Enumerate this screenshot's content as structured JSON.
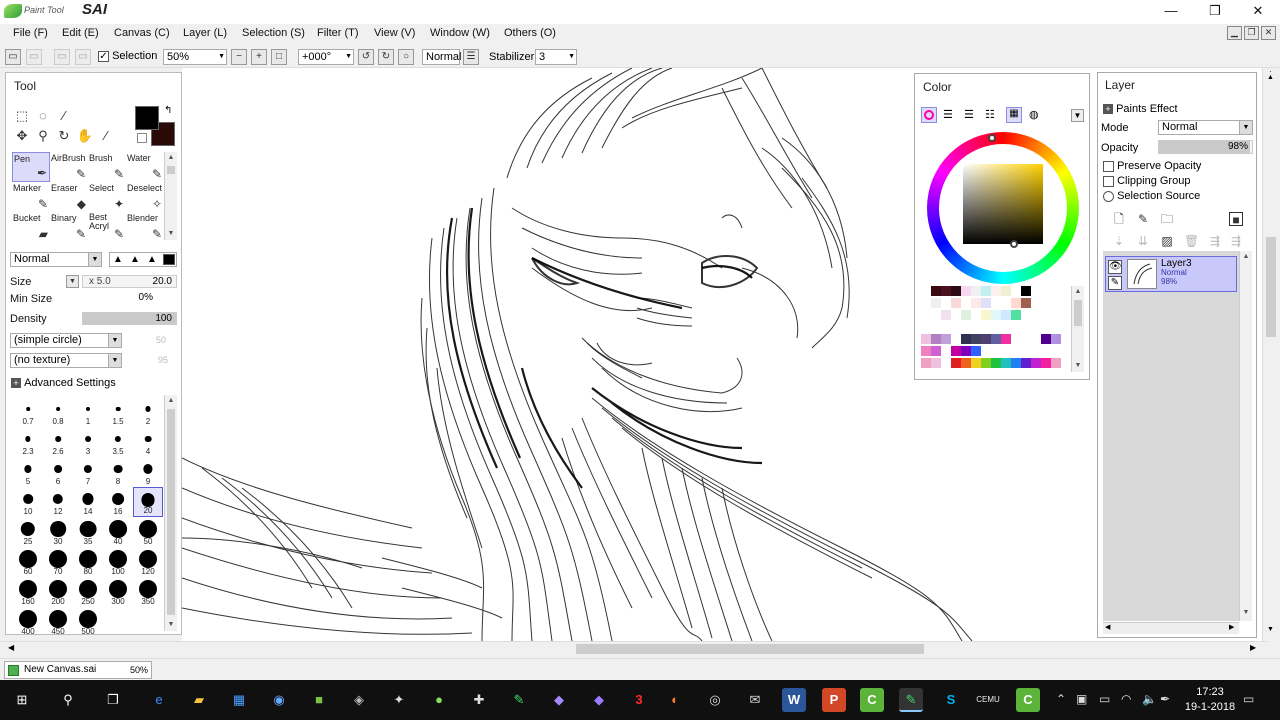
{
  "app": {
    "logo_small": "Paint Tool",
    "logo_big": "SAI"
  },
  "window_controls": {
    "minimize": "—",
    "restore": "❐",
    "close": "✕"
  },
  "menu": [
    "File (F)",
    "Edit (E)",
    "Canvas (C)",
    "Layer (L)",
    "Selection (S)",
    "Filter (T)",
    "View (V)",
    "Window (W)",
    "Others (O)"
  ],
  "toolbar": {
    "selection_checked": true,
    "selection_label": "Selection",
    "zoom": "50%",
    "rotation": "+000°",
    "blend_mode": "Normal",
    "stabilizer_label": "Stabilizer",
    "stabilizer_value": "3"
  },
  "tool_panel": {
    "title": "Tool",
    "brushes": [
      {
        "label": "Pen",
        "icon": "pen-icon",
        "glyph": "✒",
        "active": true
      },
      {
        "label": "AirBrush",
        "icon": "airbrush-icon",
        "glyph": "✎"
      },
      {
        "label": "Brush",
        "icon": "brush-icon",
        "glyph": "🖌"
      },
      {
        "label": "Water",
        "icon": "water-icon",
        "glyph": "✎"
      },
      {
        "label": "Marker",
        "icon": "marker-icon",
        "glyph": "✎"
      },
      {
        "label": "Eraser",
        "icon": "eraser-icon",
        "glyph": "◆"
      },
      {
        "label": "Select",
        "icon": "select-brush-icon",
        "glyph": "✦"
      },
      {
        "label": "Deselect",
        "icon": "deselect-brush-icon",
        "glyph": "✧"
      },
      {
        "label": "Bucket",
        "icon": "bucket-icon",
        "glyph": "▰"
      },
      {
        "label": "Binary",
        "icon": "binary-icon",
        "glyph": "✎"
      },
      {
        "label": "Best Acryl",
        "icon": "acrylic-icon",
        "glyph": "✎"
      },
      {
        "label": "Blender",
        "icon": "blender-icon",
        "glyph": "✎"
      }
    ],
    "mode": "Normal",
    "size_label": "Size",
    "size_multiplier": "x 5.0",
    "size_value": "20.0",
    "min_size_label": "Min Size",
    "min_size_value": "0%",
    "density_label": "Density",
    "density_value": "100",
    "density_fraction": 1.0,
    "brush_shape": "(simple circle)",
    "brush_shape_value": "50",
    "texture": "(no texture)",
    "texture_value": "95",
    "advanced_label": "Advanced Settings",
    "sizes": [
      "0.7",
      "0.8",
      "1",
      "1.5",
      "2",
      "2.3",
      "2.6",
      "3",
      "3.5",
      "4",
      "5",
      "6",
      "7",
      "8",
      "9",
      "10",
      "12",
      "14",
      "16",
      "20",
      "25",
      "30",
      "35",
      "40",
      "50",
      "60",
      "70",
      "80",
      "100",
      "120",
      "160",
      "200",
      "250",
      "300",
      "350",
      "400",
      "450",
      "500"
    ],
    "selected_size": "20"
  },
  "color_panel": {
    "title": "Color",
    "palette": [
      "#ffffff",
      "#3a0a10",
      "#4a1020",
      "#2a0a14",
      "#f8d8f0",
      "#f0f0f0",
      "#c0f0f0",
      "#fff0f0",
      "#f0f0d0",
      "#ffffff",
      "#000000",
      "#ffffff",
      "#ffffff",
      "#ffffff",
      "#ffffff",
      "#ffffff",
      "#f0f0f0",
      "#ffffff",
      "#f8d8d8",
      "#ffffff",
      "#ffe8e8",
      "#e0e0f8",
      "#ffffff",
      "#ffffff",
      "#ffd8d0",
      "#a06050",
      "#ffffff",
      "#ffffff",
      "#ffffff",
      "#ffffff",
      "#ffffff",
      "#ffffff",
      "#f0e0f0",
      "#ffffff",
      "#e0f0e0",
      "#ffffff",
      "#f8f8d0",
      "#e0f8f8",
      "#d0e8ff",
      "#50e0a0",
      "#ffffff",
      "#ffffff",
      "#ffffff",
      "#ffffff",
      "#ffffff",
      "#ffffff",
      "#ffffff",
      "#ffffff",
      "#ffffff",
      "#ffffff",
      "#ffffff",
      "#ffffff",
      "#ffffff",
      "#ffffff",
      "#ffffff",
      "#ffffff",
      "#ffffff",
      "#ffffff",
      "#ffffff",
      "#ffffff",
      "#f0c0e0",
      "#b080c0",
      "#c0a0d8",
      "#ffffff",
      "#303050",
      "#404060",
      "#504070",
      "#6060a0",
      "#f030a0",
      "#ffffff",
      "#ffffff",
      "#ffffff",
      "#500090",
      "#b090e0",
      "#ffffff",
      "#f080c0",
      "#d060d0",
      "#ffffff",
      "#c000a0",
      "#8000c0",
      "#3060ff",
      "#ffffff",
      "#ffffff",
      "#ffffff",
      "#ffffff",
      "#ffffff",
      "#ffffff",
      "#ffffff",
      "#ffffff",
      "#ffffff",
      "#f0a0c0",
      "#f0c0e0",
      "#ffffff",
      "#e02020",
      "#f06020",
      "#f0d020",
      "#80d020",
      "#20c040",
      "#20c0c0",
      "#2080f0",
      "#6020d0",
      "#c020d0",
      "#f020a0",
      "#f0a0c0",
      "#ffffff"
    ]
  },
  "layer_panel": {
    "title": "Layer",
    "paints_effect": "Paints Effect",
    "mode_label": "Mode",
    "mode_value": "Normal",
    "opacity_label": "Opacity",
    "opacity_value": "98%",
    "opacity_fraction": 0.98,
    "preserve_opacity": "Preserve Opacity",
    "clipping_group": "Clipping Group",
    "selection_source": "Selection Source",
    "layer": {
      "name": "Layer3",
      "mode": "Normal",
      "opacity": "98%"
    }
  },
  "status": {
    "doc_name": "New Canvas.sai",
    "doc_zoom": "50%"
  },
  "taskbar": {
    "time": "17:23",
    "date": "19-1-2018"
  }
}
